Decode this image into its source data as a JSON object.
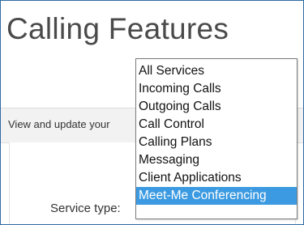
{
  "page": {
    "title": "Calling Features",
    "description": "View and update your"
  },
  "form": {
    "service_type_label": "Service type:"
  },
  "dropdown": {
    "options": [
      "All Services",
      "Incoming Calls",
      "Outgoing Calls",
      "Call Control",
      "Calling Plans",
      "Messaging",
      "Client Applications",
      "Meet-Me Conferencing"
    ],
    "selected": "Meet-Me Conferencing"
  },
  "colors": {
    "frame_border": "#2e6da4",
    "selection_highlight": "#3b9ae1"
  }
}
